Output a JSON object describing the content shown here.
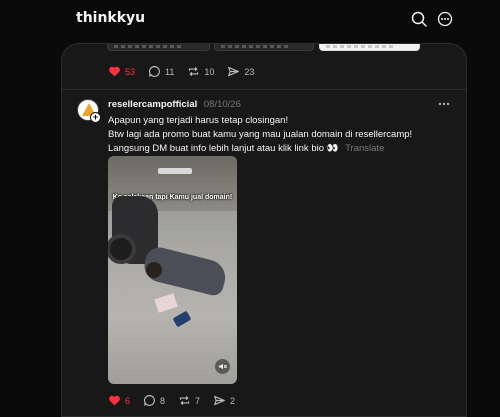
{
  "header": {
    "title": "thinkkyu",
    "search_icon": "search-icon",
    "more_icon": "more-options-icon"
  },
  "previous_post": {
    "actions": {
      "likes": "53",
      "comments": "11",
      "reposts": "10",
      "shares": "23"
    }
  },
  "post": {
    "username": "resellercampofficial",
    "date": "08/10/26",
    "lines": [
      "Apapun yang terjadi harus tetap closingan!",
      "Btw lagi ada promo buat kamu yang mau jualan domain di resellercamp!",
      "Langsung DM buat info lebih lanjut atau klik link bio 👀"
    ],
    "translate_label": "Translate",
    "media_caption": "Ke celakaan tapi Kamu jual domain!",
    "actions": {
      "likes": "6",
      "comments": "8",
      "reposts": "7",
      "shares": "2"
    }
  },
  "colors": {
    "background": "#0a0a0a",
    "card": "#181818",
    "liked": "#ff3040",
    "muted_text": "#777777"
  }
}
